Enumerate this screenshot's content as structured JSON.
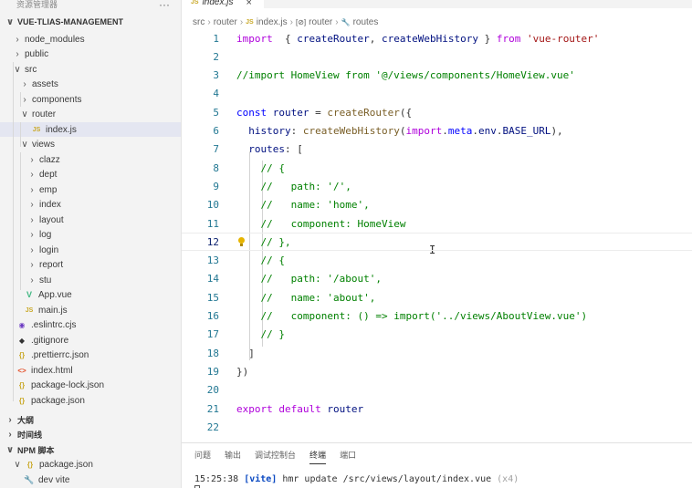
{
  "sidebar": {
    "header_title": "资源管理器",
    "more": "···",
    "items": [
      {
        "label": "VUE-TLIAS-MANAGEMENT",
        "chev": "∨",
        "icon": "",
        "kind": "section",
        "indent": 0
      },
      {
        "label": "node_modules",
        "chev": "›",
        "icon": "",
        "kind": "folder",
        "indent": 1
      },
      {
        "label": "public",
        "chev": "›",
        "icon": "",
        "kind": "folder",
        "indent": 1
      },
      {
        "label": "src",
        "chev": "∨",
        "icon": "",
        "kind": "folder",
        "indent": 1
      },
      {
        "label": "assets",
        "chev": "›",
        "icon": "",
        "kind": "folder",
        "indent": 2
      },
      {
        "label": "components",
        "chev": "›",
        "icon": "",
        "kind": "folder",
        "indent": 2
      },
      {
        "label": "router",
        "chev": "∨",
        "icon": "",
        "kind": "folder",
        "indent": 2
      },
      {
        "label": "index.js",
        "chev": "",
        "icon": "JS",
        "kind": "js",
        "indent": 3,
        "selected": true
      },
      {
        "label": "views",
        "chev": "∨",
        "icon": "",
        "kind": "folder",
        "indent": 2
      },
      {
        "label": "clazz",
        "chev": "›",
        "icon": "",
        "kind": "folder",
        "indent": 3
      },
      {
        "label": "dept",
        "chev": "›",
        "icon": "",
        "kind": "folder",
        "indent": 3
      },
      {
        "label": "emp",
        "chev": "›",
        "icon": "",
        "kind": "folder",
        "indent": 3
      },
      {
        "label": "index",
        "chev": "›",
        "icon": "",
        "kind": "folder",
        "indent": 3
      },
      {
        "label": "layout",
        "chev": "›",
        "icon": "",
        "kind": "folder",
        "indent": 3
      },
      {
        "label": "log",
        "chev": "›",
        "icon": "",
        "kind": "folder",
        "indent": 3
      },
      {
        "label": "login",
        "chev": "›",
        "icon": "",
        "kind": "folder",
        "indent": 3
      },
      {
        "label": "report",
        "chev": "›",
        "icon": "",
        "kind": "folder",
        "indent": 3
      },
      {
        "label": "stu",
        "chev": "›",
        "icon": "",
        "kind": "folder",
        "indent": 3
      },
      {
        "label": "App.vue",
        "chev": "",
        "icon": "V",
        "kind": "vue",
        "indent": 2
      },
      {
        "label": "main.js",
        "chev": "",
        "icon": "JS",
        "kind": "js",
        "indent": 2
      },
      {
        "label": ".eslintrc.cjs",
        "chev": "",
        "icon": "◉",
        "kind": "eslint",
        "indent": 1
      },
      {
        "label": ".gitignore",
        "chev": "",
        "icon": "◆",
        "kind": "git",
        "indent": 1
      },
      {
        "label": ".prettierrc.json",
        "chev": "",
        "icon": "{}",
        "kind": "json",
        "indent": 1
      },
      {
        "label": "index.html",
        "chev": "",
        "icon": "<>",
        "kind": "html",
        "indent": 1
      },
      {
        "label": "package-lock.json",
        "chev": "",
        "icon": "{}",
        "kind": "json",
        "indent": 1
      },
      {
        "label": "package.json",
        "chev": "",
        "icon": "{}",
        "kind": "json",
        "indent": 1
      },
      {
        "label": "大纲",
        "chev": "›",
        "icon": "",
        "kind": "section",
        "indent": 0
      },
      {
        "label": "时间线",
        "chev": "›",
        "icon": "",
        "kind": "section",
        "indent": 0
      },
      {
        "label": "NPM 脚本",
        "chev": "∨",
        "icon": "",
        "kind": "section",
        "indent": 0
      },
      {
        "label": "package.json",
        "chev": "∨",
        "icon": "{}",
        "kind": "json",
        "indent": 1
      },
      {
        "label": "dev vite",
        "chev": "",
        "icon": "🔧",
        "kind": "wrench",
        "indent": 2
      }
    ]
  },
  "editor": {
    "tab_icon": "JS",
    "tab_label": "index.js",
    "tab_close": "×",
    "breadcrumb": {
      "src": "src",
      "router": "router",
      "file_icon": "JS",
      "file": "index.js",
      "symbol_icon": "[⊘]",
      "symbol": "router",
      "prop_icon": "🔧",
      "prop": "routes"
    },
    "lines": [
      {
        "n": "1",
        "tokens": [
          [
            "kw2",
            "import"
          ],
          [
            "",
            "  { "
          ],
          [
            "var",
            "createRouter"
          ],
          [
            "",
            ", "
          ],
          [
            "var",
            "createWebHistory"
          ],
          [
            "",
            " } "
          ],
          [
            "kw2",
            "from"
          ],
          [
            "",
            " "
          ],
          [
            "str",
            "'vue-router'"
          ]
        ]
      },
      {
        "n": "2",
        "tokens": []
      },
      {
        "n": "3",
        "tokens": [
          [
            "cm",
            "//import HomeView from '@/views/components/HomeView.vue'"
          ]
        ]
      },
      {
        "n": "4",
        "tokens": []
      },
      {
        "n": "5",
        "tokens": [
          [
            "kw",
            "const"
          ],
          [
            "",
            " "
          ],
          [
            "var",
            "router"
          ],
          [
            "",
            " = "
          ],
          [
            "fn",
            "createRouter"
          ],
          [
            "",
            "({"
          ]
        ]
      },
      {
        "n": "6",
        "tokens": [
          [
            "",
            "  "
          ],
          [
            "prop",
            "history"
          ],
          [
            "",
            ": "
          ],
          [
            "fn",
            "createWebHistory"
          ],
          [
            "",
            "("
          ],
          [
            "kw2",
            "import"
          ],
          [
            "",
            "."
          ],
          [
            "kw",
            "meta"
          ],
          [
            "",
            "."
          ],
          [
            "prop",
            "env"
          ],
          [
            "",
            "."
          ],
          [
            "prop",
            "BASE_URL"
          ],
          [
            "",
            "),"
          ]
        ]
      },
      {
        "n": "7",
        "tokens": [
          [
            "",
            "  "
          ],
          [
            "prop",
            "routes"
          ],
          [
            "",
            ": ["
          ]
        ]
      },
      {
        "n": "8",
        "tokens": [
          [
            "",
            "    "
          ],
          [
            "cm",
            "// {"
          ]
        ]
      },
      {
        "n": "9",
        "tokens": [
          [
            "",
            "    "
          ],
          [
            "cm",
            "//   path: '/',"
          ]
        ]
      },
      {
        "n": "10",
        "tokens": [
          [
            "",
            "    "
          ],
          [
            "cm",
            "//   name: 'home',"
          ]
        ]
      },
      {
        "n": "11",
        "tokens": [
          [
            "",
            "    "
          ],
          [
            "cm",
            "//   component: HomeView"
          ]
        ]
      },
      {
        "n": "12",
        "tokens": [
          [
            "",
            "    "
          ],
          [
            "cm",
            "// },"
          ]
        ]
      },
      {
        "n": "13",
        "tokens": [
          [
            "",
            "    "
          ],
          [
            "cm",
            "// {"
          ]
        ]
      },
      {
        "n": "14",
        "tokens": [
          [
            "",
            "    "
          ],
          [
            "cm",
            "//   path: '/about',"
          ]
        ]
      },
      {
        "n": "15",
        "tokens": [
          [
            "",
            "    "
          ],
          [
            "cm",
            "//   name: 'about',"
          ]
        ]
      },
      {
        "n": "16",
        "tokens": [
          [
            "",
            "    "
          ],
          [
            "cm",
            "//   component: () => import('../views/AboutView.vue')"
          ]
        ]
      },
      {
        "n": "17",
        "tokens": [
          [
            "",
            "    "
          ],
          [
            "cm",
            "// }"
          ]
        ]
      },
      {
        "n": "18",
        "tokens": [
          [
            "",
            "  ]"
          ]
        ]
      },
      {
        "n": "19",
        "tokens": [
          [
            "",
            "})"
          ]
        ]
      },
      {
        "n": "20",
        "tokens": []
      },
      {
        "n": "21",
        "tokens": [
          [
            "kw2",
            "export"
          ],
          [
            "",
            " "
          ],
          [
            "kw2",
            "default"
          ],
          [
            "",
            " "
          ],
          [
            "var",
            "router"
          ]
        ]
      },
      {
        "n": "22",
        "tokens": []
      }
    ],
    "current_line": "12"
  },
  "panel": {
    "tabs": [
      {
        "label": "问题",
        "active": false
      },
      {
        "label": "输出",
        "active": false
      },
      {
        "label": "调试控制台",
        "active": false
      },
      {
        "label": "终端",
        "active": true
      },
      {
        "label": "端口",
        "active": false
      }
    ],
    "terminal": {
      "time": "15:25:38",
      "tag": "[vite]",
      "message": " hmr update /src/views/layout/index.vue ",
      "count": "(x4)"
    }
  }
}
